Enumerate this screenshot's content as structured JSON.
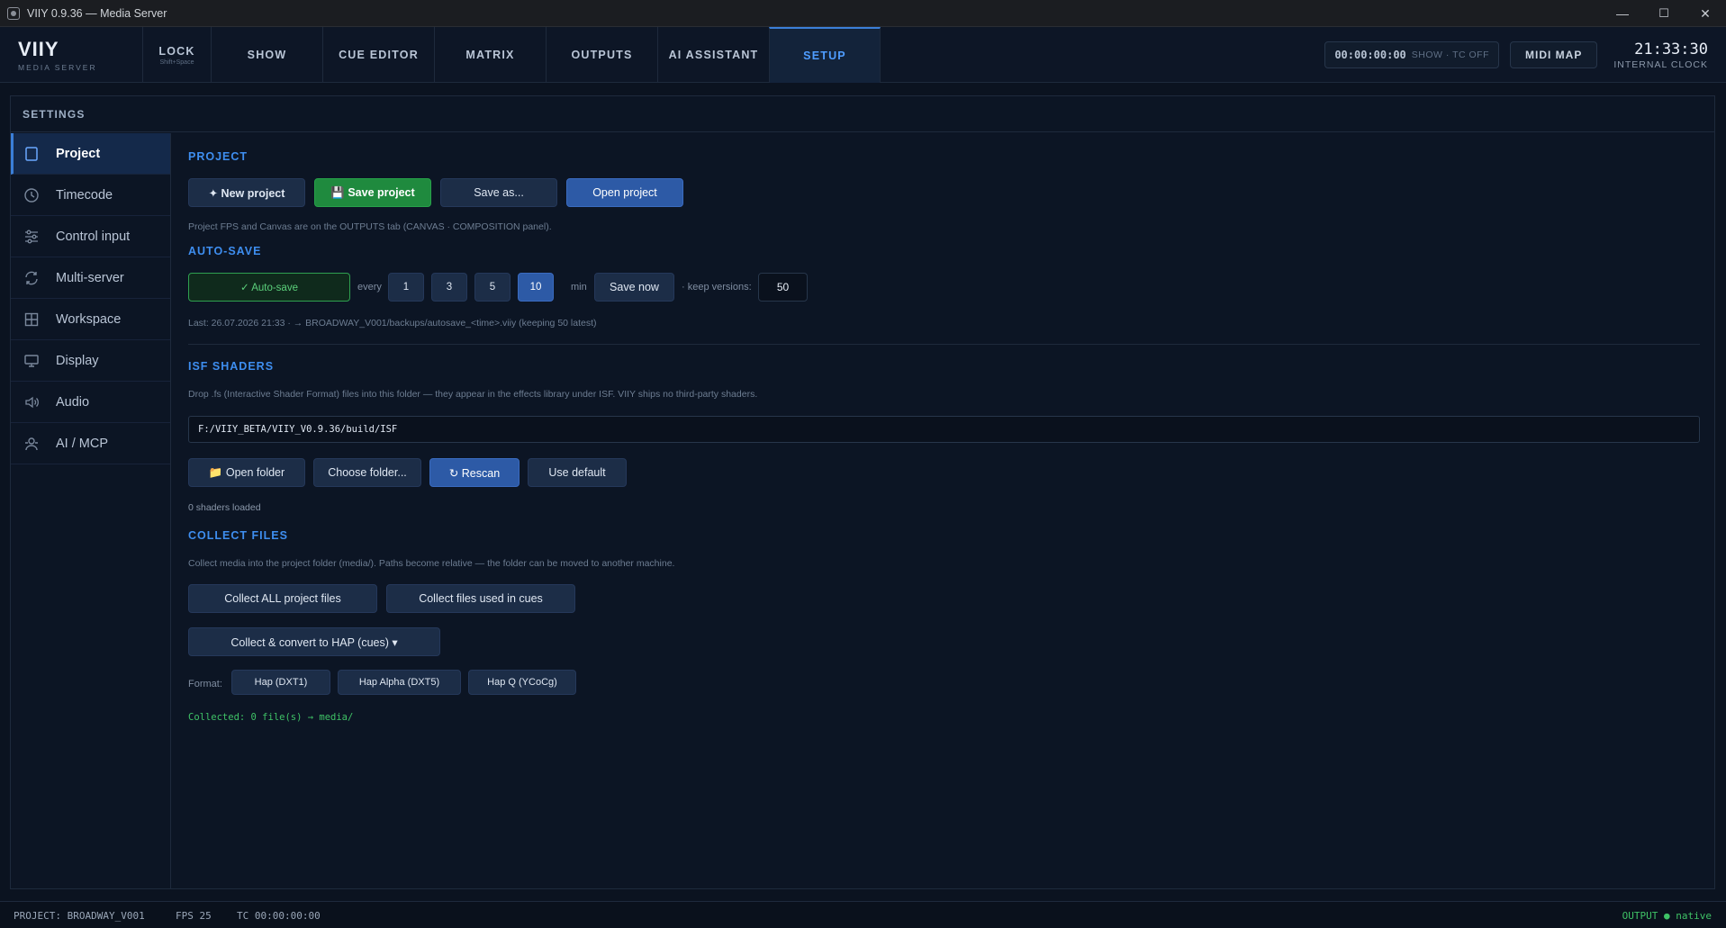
{
  "window": {
    "title": "VIIY 0.9.36 — Media Server",
    "minimize": "—",
    "maximize": "☐",
    "close": "✕"
  },
  "brand": {
    "name": "VIIY",
    "sub": "MEDIA SERVER"
  },
  "nav": {
    "lock": {
      "label": "LOCK",
      "sub": "Shift+Space"
    },
    "tabs": [
      "SHOW",
      "CUE EDITOR",
      "MATRIX",
      "OUTPUTS",
      "AI ASSISTANT",
      "SETUP"
    ],
    "active_tab": "SETUP"
  },
  "timecode": {
    "value": "00:00:00:00",
    "mode": "SHOW · TC OFF"
  },
  "midi_map": "MIDI MAP",
  "clock": {
    "time": "21:33:30",
    "source": "INTERNAL CLOCK"
  },
  "settings": {
    "title": "SETTINGS"
  },
  "sidebar": {
    "items": [
      {
        "label": "Project",
        "icon": "project-icon"
      },
      {
        "label": "Timecode",
        "icon": "clock-icon"
      },
      {
        "label": "Control input",
        "icon": "sliders-icon"
      },
      {
        "label": "Multi-server",
        "icon": "sync-icon"
      },
      {
        "label": "Workspace",
        "icon": "grid-icon"
      },
      {
        "label": "Display",
        "icon": "monitor-icon"
      },
      {
        "label": "Audio",
        "icon": "speaker-icon"
      },
      {
        "label": "AI / MCP",
        "icon": "robot-icon"
      }
    ],
    "active": "Project"
  },
  "project": {
    "title": "PROJECT",
    "new": "✦ New project",
    "save": "💾 Save project",
    "save_as": "Save as...",
    "open": "Open project",
    "note": "Project FPS and Canvas are on the OUTPUTS tab (CANVAS · COMPOSITION panel)."
  },
  "autosave": {
    "title": "AUTO-SAVE",
    "toggle": "✓ Auto-save",
    "every": "every",
    "intervals": [
      "1",
      "3",
      "5",
      "10"
    ],
    "selected_interval": "10",
    "unit": "min",
    "save_now": "Save now",
    "keep_label": "· keep versions:",
    "keep_value": "50",
    "last": "Last: 26.07.2026  21:33   · → BROADWAY_V001/backups/autosave_<time>.viiy  (keeping 50 latest)"
  },
  "isf": {
    "title": "ISF SHADERS",
    "note": "Drop .fs (Interactive Shader Format) files into this folder — they appear in the effects library under ISF. VIIY ships no third-party shaders.",
    "path": "F:/VIIY_BETA/VIIY_V0.9.36/build/ISF",
    "open_folder": "📁 Open folder",
    "choose_folder": "Choose folder...",
    "rescan": "↻ Rescan",
    "use_default": "Use default",
    "status": "0 shaders loaded"
  },
  "collect": {
    "title": "COLLECT FILES",
    "note": "Collect media into the project folder (media/). Paths become relative — the folder can be moved to another machine.",
    "all": "Collect ALL project files",
    "cues": "Collect files used in cues",
    "hap": "Collect & convert to HAP (cues) ▾",
    "format_label": "Format:",
    "formats": [
      "Hap (DXT1)",
      "Hap Alpha (DXT5)",
      "Hap Q (YCoCg)"
    ],
    "status": "Collected: 0 file(s) → media/"
  },
  "statusbar": {
    "project": "PROJECT: BROADWAY_V001",
    "fps": "FPS 25",
    "tc": "TC 00:00:00:00",
    "output": "OUTPUT ● native"
  },
  "colors": {
    "accent": "#3e8ef0",
    "green": "#1f8a3e",
    "bg": "#0b1320"
  }
}
